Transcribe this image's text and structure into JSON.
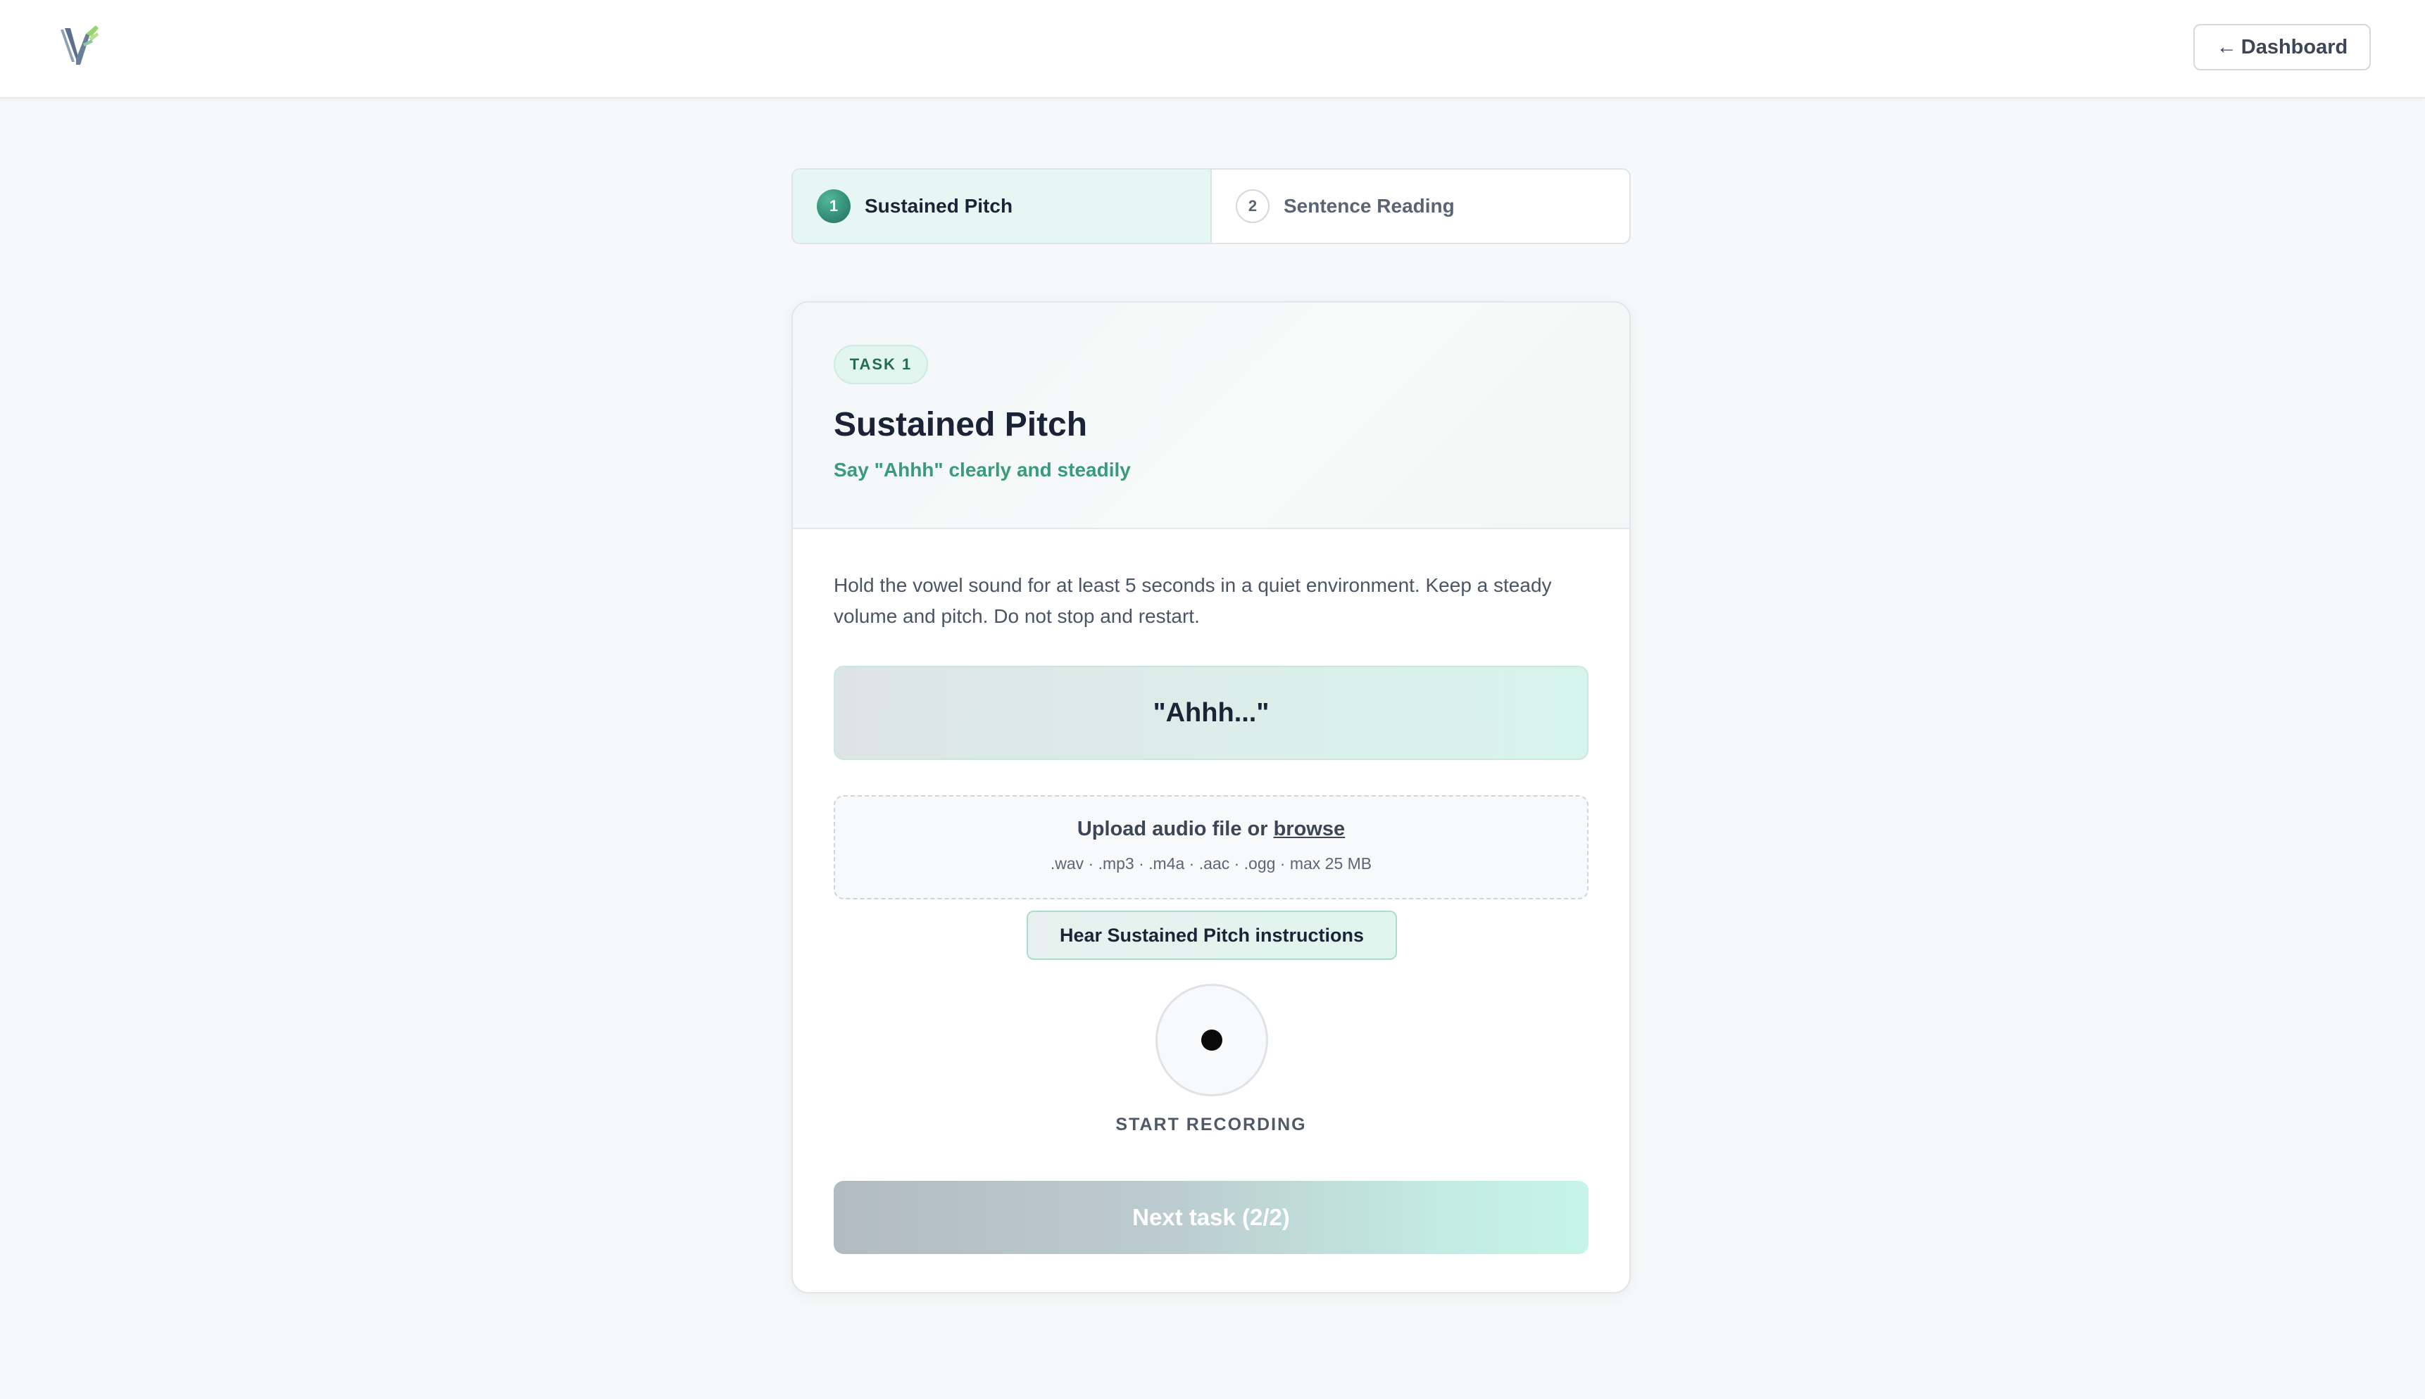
{
  "header": {
    "logo_icon": "v-logo-icon",
    "dashboard_button": {
      "arrow": "←",
      "label": "Dashboard"
    }
  },
  "stepper": {
    "steps": [
      {
        "number": "1",
        "label": "Sustained Pitch",
        "active": true
      },
      {
        "number": "2",
        "label": "Sentence Reading",
        "active": false
      }
    ]
  },
  "task": {
    "badge": "TASK 1",
    "title": "Sustained Pitch",
    "subtitle": "Say \"Ahhh\" clearly and steadily",
    "description": "Hold the vowel sound for at least 5 seconds in a quiet environment. Keep a steady volume and pitch. Do not stop and restart.",
    "prompt": "\"Ahhh...\"",
    "upload": {
      "label": "Upload audio file or",
      "browse": "browse",
      "formats": ".wav · .mp3 · .m4a · .aac · .ogg · max 25 MB"
    },
    "hear_button": "Hear Sustained Pitch instructions",
    "record_label": "START RECORDING",
    "next_button": "Next task (2/2)"
  },
  "colors": {
    "accent": "#3a9a7e",
    "page_background": "#f6f8f9",
    "record_dot": "#0a0a0a"
  }
}
